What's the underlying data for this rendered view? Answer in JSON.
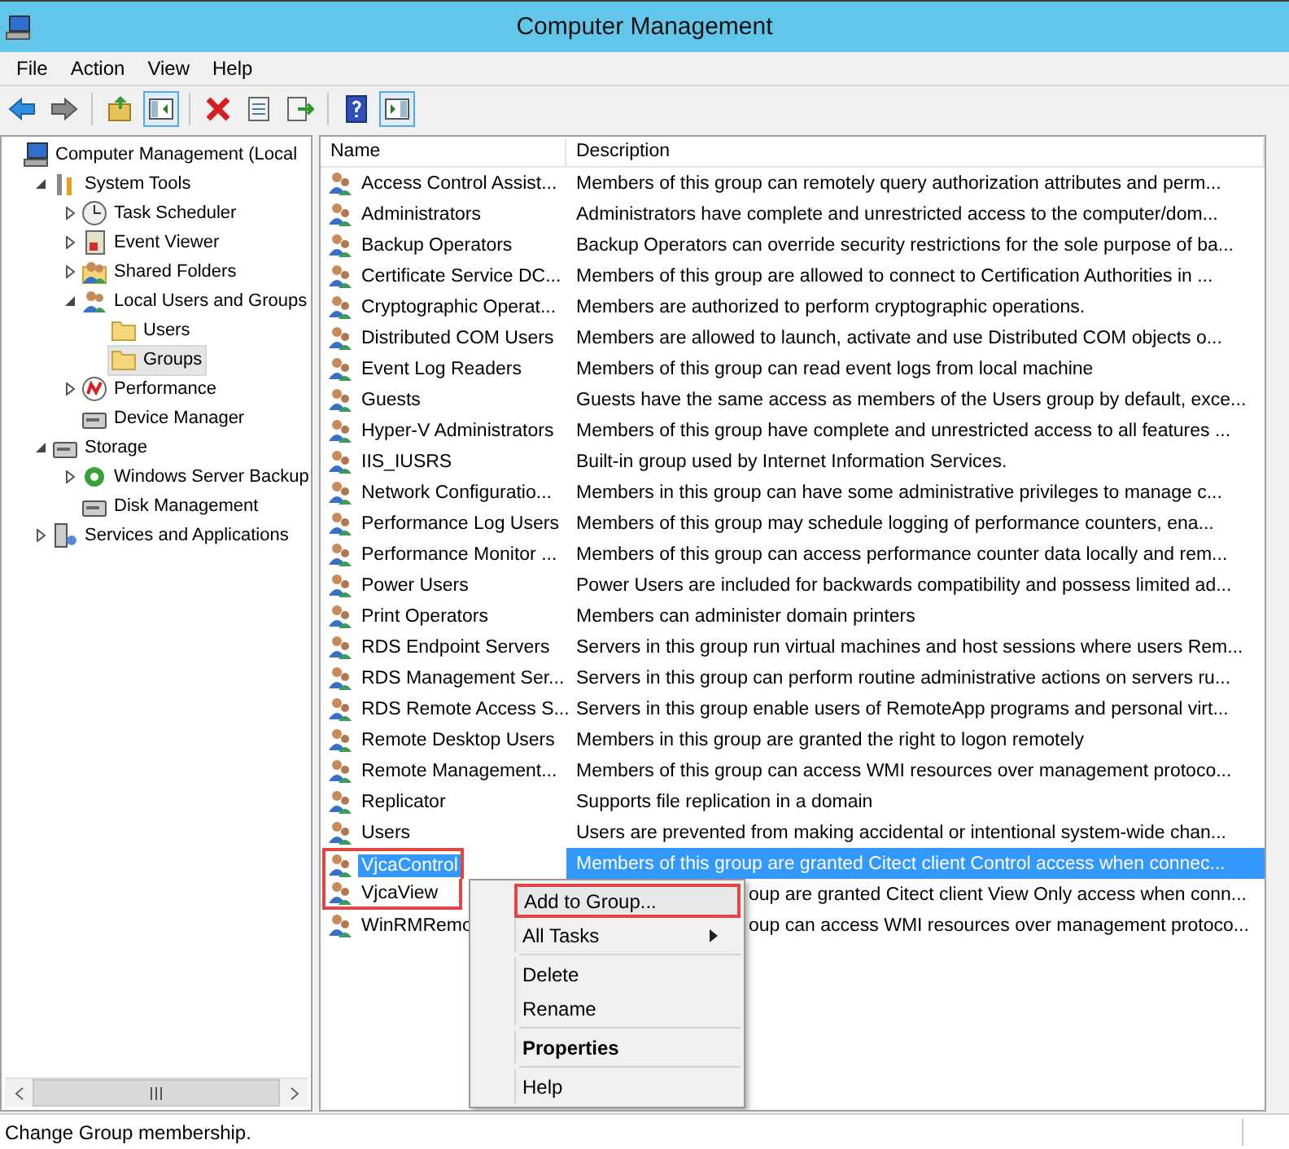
{
  "window": {
    "title": "Computer Management"
  },
  "menu_bar": [
    "File",
    "Action",
    "View",
    "Help"
  ],
  "toolbar": [
    {
      "kind": "back",
      "pressed": false
    },
    {
      "kind": "forward",
      "pressed": false
    },
    {
      "kind": "separator"
    },
    {
      "kind": "up",
      "pressed": false
    },
    {
      "kind": "tree-toggle",
      "pressed": true
    },
    {
      "kind": "separator"
    },
    {
      "kind": "delete",
      "pressed": false
    },
    {
      "kind": "properties",
      "pressed": false
    },
    {
      "kind": "export",
      "pressed": false
    },
    {
      "kind": "separator"
    },
    {
      "kind": "help",
      "pressed": false
    },
    {
      "kind": "action-pane",
      "pressed": true
    }
  ],
  "tree": {
    "items": [
      {
        "label": "Computer Management (Local",
        "kind": "computer",
        "selected": false,
        "children": [
          {
            "label": "System Tools",
            "kind": "tools",
            "expanded": true,
            "selected": false,
            "children": [
              {
                "label": "Task Scheduler",
                "kind": "clock",
                "expanded": false,
                "selected": false
              },
              {
                "label": "Event Viewer",
                "kind": "viewer",
                "expanded": false,
                "selected": false
              },
              {
                "label": "Shared Folders",
                "kind": "share",
                "expanded": false,
                "selected": false
              },
              {
                "label": "Local Users and Groups",
                "kind": "users",
                "expanded": true,
                "selected": false,
                "children": [
                  {
                    "label": "Users",
                    "kind": "folder",
                    "selected": false
                  },
                  {
                    "label": "Groups",
                    "kind": "folder",
                    "selected": true
                  }
                ]
              },
              {
                "label": "Performance",
                "kind": "perf",
                "expanded": false,
                "selected": false
              },
              {
                "label": "Device Manager",
                "kind": "device",
                "selected": false
              }
            ]
          },
          {
            "label": "Storage",
            "kind": "storage",
            "expanded": true,
            "selected": false,
            "children": [
              {
                "label": "Windows Server Backup",
                "kind": "backup",
                "expanded": false,
                "selected": false
              },
              {
                "label": "Disk Management",
                "kind": "disk",
                "selected": false
              }
            ]
          },
          {
            "label": "Services and Applications",
            "kind": "services",
            "expanded": false,
            "selected": false
          }
        ]
      }
    ]
  },
  "table": {
    "columns": [
      "Name",
      "Description"
    ],
    "rows": [
      {
        "name": "Access Control Assist...",
        "description": "Members of this group can remotely query authorization attributes and perm...",
        "selected": false,
        "outlined": false
      },
      {
        "name": "Administrators",
        "description": "Administrators have complete and unrestricted access to the computer/dom...",
        "selected": false,
        "outlined": false
      },
      {
        "name": "Backup Operators",
        "description": "Backup Operators can override security restrictions for the sole purpose of ba...",
        "selected": false,
        "outlined": false
      },
      {
        "name": "Certificate Service DC...",
        "description": "Members of this group are allowed to connect to Certification Authorities in ...",
        "selected": false,
        "outlined": false
      },
      {
        "name": "Cryptographic Operat...",
        "description": "Members are authorized to perform cryptographic operations.",
        "selected": false,
        "outlined": false
      },
      {
        "name": "Distributed COM Users",
        "description": "Members are allowed to launch, activate and use Distributed COM objects o...",
        "selected": false,
        "outlined": false
      },
      {
        "name": "Event Log Readers",
        "description": "Members of this group can read event logs from local machine",
        "selected": false,
        "outlined": false
      },
      {
        "name": "Guests",
        "description": "Guests have the same access as members of the Users group by default, exce...",
        "selected": false,
        "outlined": false
      },
      {
        "name": "Hyper-V Administrators",
        "description": "Members of this group have complete and unrestricted access to all features ...",
        "selected": false,
        "outlined": false
      },
      {
        "name": "IIS_IUSRS",
        "description": "Built-in group used by Internet Information Services.",
        "selected": false,
        "outlined": false
      },
      {
        "name": "Network Configuratio...",
        "description": "Members in this group can have some administrative privileges to manage c...",
        "selected": false,
        "outlined": false
      },
      {
        "name": "Performance Log Users",
        "description": "Members of this group may schedule logging of performance counters, ena...",
        "selected": false,
        "outlined": false
      },
      {
        "name": "Performance Monitor ...",
        "description": "Members of this group can access performance counter data locally and rem...",
        "selected": false,
        "outlined": false
      },
      {
        "name": "Power Users",
        "description": "Power Users are included for backwards compatibility and possess limited ad...",
        "selected": false,
        "outlined": false
      },
      {
        "name": "Print Operators",
        "description": "Members can administer domain printers",
        "selected": false,
        "outlined": false
      },
      {
        "name": "RDS Endpoint Servers",
        "description": "Servers in this group run virtual machines and host sessions where users Rem...",
        "selected": false,
        "outlined": false
      },
      {
        "name": "RDS Management Ser...",
        "description": "Servers in this group can perform routine administrative actions on servers ru...",
        "selected": false,
        "outlined": false
      },
      {
        "name": "RDS Remote Access S...",
        "description": "Servers in this group enable users of RemoteApp programs and personal virt...",
        "selected": false,
        "outlined": false
      },
      {
        "name": "Remote Desktop Users",
        "description": "Members in this group are granted the right to logon remotely",
        "selected": false,
        "outlined": false
      },
      {
        "name": "Remote Management...",
        "description": "Members of this group can access WMI resources over management protoco...",
        "selected": false,
        "outlined": false
      },
      {
        "name": "Replicator",
        "description": "Supports file replication in a domain",
        "selected": false,
        "outlined": false
      },
      {
        "name": "Users",
        "description": "Users are prevented from making accidental or intentional system-wide chan...",
        "selected": false,
        "outlined": false
      },
      {
        "name": "VjcaControl",
        "description": "Members of this group are granted Citect client Control access when connec...",
        "selected": true,
        "outlined": true
      },
      {
        "name": "VjcaView",
        "description": "oup are granted Citect client View Only access when conn...",
        "selected": false,
        "outlined": true
      },
      {
        "name": "WinRMRemo",
        "description": "oup can access WMI resources over management protoco...",
        "selected": false,
        "outlined": false
      }
    ]
  },
  "context_menu": [
    {
      "kind": "item",
      "label": "Add to Group...",
      "outlined": true,
      "default": false,
      "submenu": false
    },
    {
      "kind": "item",
      "label": "All Tasks",
      "outlined": false,
      "default": false,
      "submenu": true
    },
    {
      "kind": "separator"
    },
    {
      "kind": "item",
      "label": "Delete",
      "outlined": false,
      "default": false,
      "submenu": false
    },
    {
      "kind": "item",
      "label": "Rename",
      "outlined": false,
      "default": false,
      "submenu": false
    },
    {
      "kind": "separator"
    },
    {
      "kind": "item",
      "label": "Properties",
      "outlined": false,
      "default": true,
      "submenu": false
    },
    {
      "kind": "separator"
    },
    {
      "kind": "item",
      "label": "Help",
      "outlined": false,
      "default": false,
      "submenu": false
    }
  ],
  "status_bar": "Change Group membership."
}
